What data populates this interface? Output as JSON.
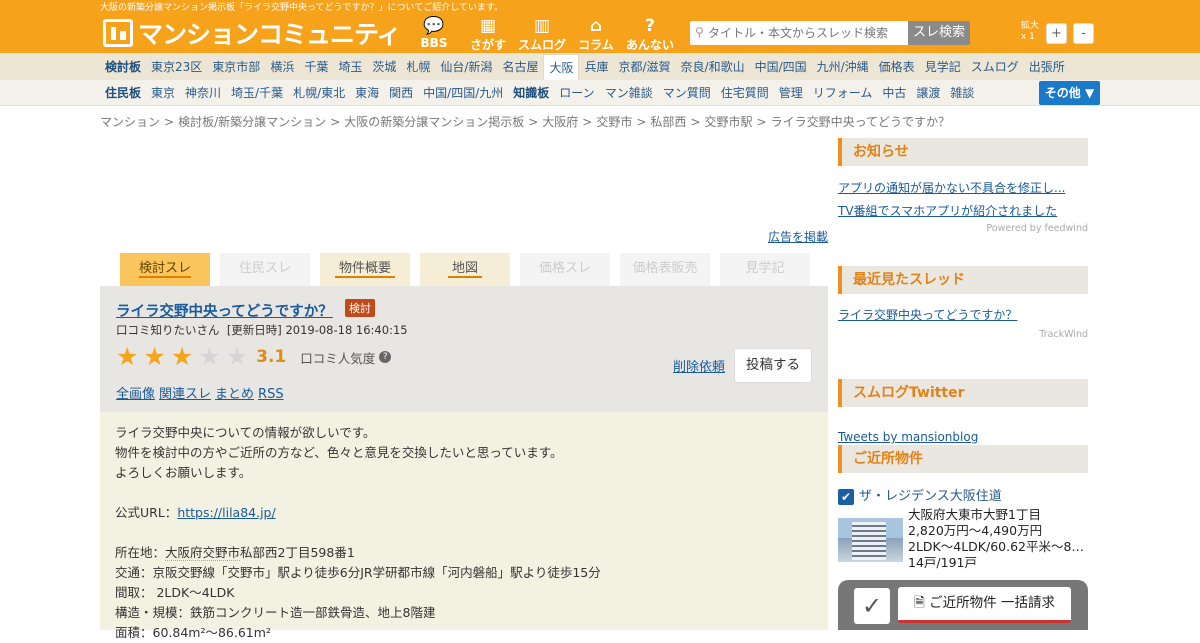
{
  "site": {
    "top_note": "大阪の新築分譲マンション掲示板「ライラ交野中央ってどうですか？」についてご紹介しています。",
    "logo_text": "マンションコミュニティ",
    "header_color": "#f7a21b",
    "nav_icons": [
      {
        "icon": "chat-bubble-icon",
        "label": "BBS"
      },
      {
        "icon": "building-search-icon",
        "label": "さがす"
      },
      {
        "icon": "buildings-icon",
        "label": "スムログ"
      },
      {
        "icon": "house-icon",
        "label": "コラム"
      },
      {
        "icon": "question-icon",
        "label": "あんない"
      }
    ],
    "search": {
      "placeholder": "タイトル・本文からスレッド検索",
      "button": "スレ検索"
    },
    "zoom": {
      "label": "拡大",
      "value": "x 1",
      "plus": "+",
      "minus": "-"
    }
  },
  "nav1": [
    "検討板",
    "東京23区",
    "東京市部",
    "横浜",
    "千葉",
    "埼玉",
    "茨城",
    "札幌",
    "仙台/新潟",
    "名古屋",
    "大阪",
    "兵庫",
    "京都/滋賀",
    "奈良/和歌山",
    "中国/四国",
    "九州/沖縄",
    "価格表",
    "見学記",
    "スムログ",
    "出張所"
  ],
  "nav2": [
    "住民板",
    "東京",
    "神奈川",
    "埼玉/千葉",
    "札幌/東北",
    "東海",
    "関西",
    "中国/四国/九州",
    "知識板",
    "ローン",
    "マン雑談",
    "マン質問",
    "住宅質問",
    "管理",
    "リフォーム",
    "中古",
    "譲渡",
    "雑談"
  ],
  "nav_more": "その他 ▼",
  "breadcrumb": [
    "マンション",
    "検討板/新築分譲マンション",
    "大阪の新築分譲マンション掲示板",
    "大阪府",
    "交野市",
    "私部西",
    "交野市駅",
    "ライラ交野中央ってどうですか？"
  ],
  "ad_link": "広告を掲載",
  "tabs": [
    "検討スレ",
    "住民スレ",
    "物件概要",
    "地図",
    "価格スレ",
    "価格表販売",
    "見学記"
  ],
  "thread": {
    "title": "ライラ交野中央ってどうですか？",
    "badge": "検討",
    "author": "口コミ知りたいさん",
    "updated": "[更新日時] 2019-08-18 16:40:15",
    "rating": 3.1,
    "score_text": "3.1",
    "popularity_label": "口コミ人気度",
    "delete_link": "削除依頼",
    "post_button": "投稿する",
    "links": [
      "全画像",
      "関連スレ",
      "まとめ",
      "RSS"
    ]
  },
  "post": {
    "line1": "ライラ交野中央についての情報が欲しいです。",
    "line2": "物件を検討中の方やご近所の方など、色々と意見を交換したいと思っています。",
    "line3": "よろしくお願いします。",
    "url_label": "公式URL：",
    "url": "https://lila84.jp/",
    "addr_label": "所在地：",
    "addr_link": "大阪府交野市",
    "addr_rest": "私部西2丁目598番1",
    "traffic": "交通：京阪交野線「交野市」駅より徒歩6分JR学研都市線「河内磐船」駅より徒歩15分",
    "madori": "間取：  2LDK〜4LDK",
    "structure": "構造・規模：鉄筋コンクリート造一部鉄骨造、地上8階建",
    "area": "面積：60.84m²〜86.61m²"
  },
  "sidebar": {
    "news_title": "お知らせ",
    "news": [
      "アプリの通知が届かない不具合を修正し...",
      "TV番組でスマホアプリが紹介されました"
    ],
    "news_powered": "Powered by feedwind",
    "recent_title": "最近見たスレッド",
    "recent": "ライラ交野中央ってどうですか？",
    "recent_powered": "TrackWind",
    "twitter_title": "スムログTwitter",
    "twitter_link": "Tweets by mansionblog",
    "nearby_title": "ご近所物件",
    "property": {
      "name": "ザ・レジデンス大阪住道",
      "address": "大阪府大東市大野1丁目",
      "price": "2,820万円～4,490万円",
      "layout": "2LDK～4LDK/60.62平米～8…",
      "units": "14戸/191戸"
    },
    "bulk_button": "ご近所物件 一括請求"
  }
}
